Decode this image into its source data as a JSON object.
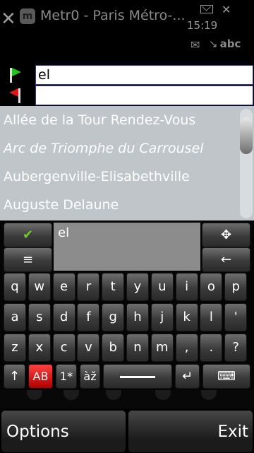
{
  "statusbar": {
    "app_icon_letter": "m",
    "app_title": "Metr0 - Paris Métro-...",
    "time": "15:19",
    "input_mode": "abc",
    "icons": [
      "close-icon",
      "app-icon",
      "mail-icon",
      "signal-icon",
      "envelope-icon"
    ]
  },
  "route": {
    "from_value": "el",
    "to_value": "",
    "from_flag_color": "#1ec81e",
    "to_flag_color": "#e01818"
  },
  "results": [
    "Allée de la Tour Rendez-Vous",
    "Arc de Triomphe du Carrousel",
    "Aubergenville-Elisabethville",
    "Auguste Delaune"
  ],
  "keyboard": {
    "preview_text": "el",
    "ok_glyph": "✔",
    "menu_glyph": "≡",
    "move_glyph": "✥",
    "backspace_glyph": "←",
    "row1": [
      "q",
      "w",
      "e",
      "r",
      "t",
      "y",
      "u",
      "i",
      "o",
      "p"
    ],
    "row2": [
      "a",
      "s",
      "d",
      "f",
      "g",
      "h",
      "j",
      "k",
      "l",
      "'"
    ],
    "row3": [
      "z",
      "x",
      "c",
      "v",
      "b",
      "n",
      "m",
      ",",
      ".",
      "?"
    ],
    "shift_glyph": "↑",
    "case_label": "AB",
    "numbers_label": "1*",
    "accents_label": "àž",
    "enter_glyph": "↵",
    "layout_glyph": "⌨",
    "accent_color": "#e01818"
  },
  "softkeys": {
    "left": "Options",
    "right": "Exit"
  }
}
